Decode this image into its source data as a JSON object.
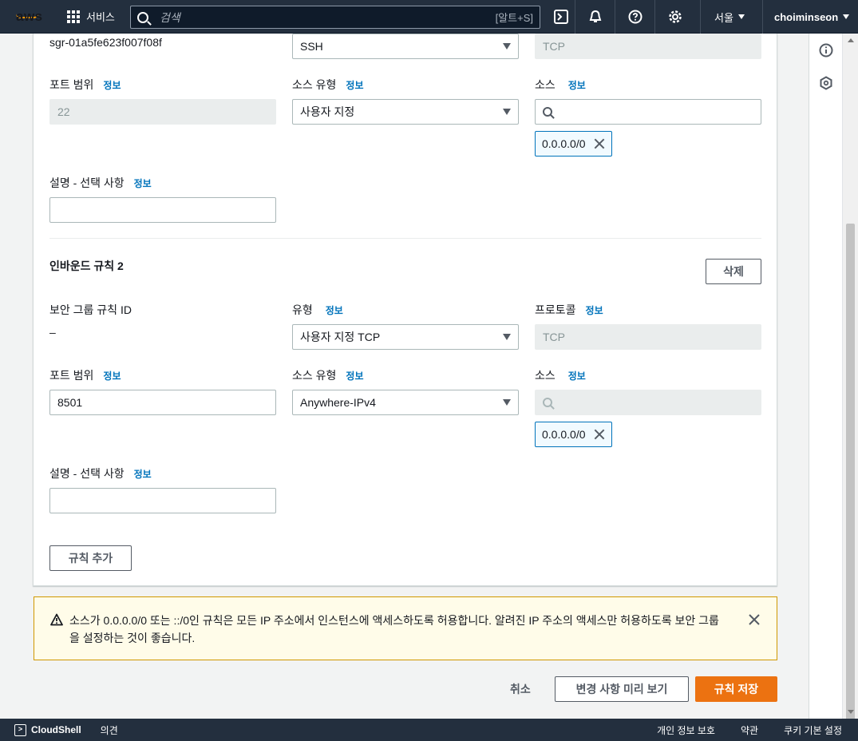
{
  "nav": {
    "logo": "aws",
    "services": "서비스",
    "search_placeholder": "검색",
    "search_shortcut": "[알트+S]",
    "region": "서울",
    "user": "choiminseon"
  },
  "rule1": {
    "sg_rule_id": "sgr-01a5fe623f007f08f",
    "type_value": "SSH",
    "protocol_value": "TCP",
    "port_label": "포트 범위",
    "port_value": "22",
    "source_type_label": "소스 유형",
    "source_type_value": "사용자 지정",
    "source_label": "소스",
    "source_token": "0.0.0.0/0",
    "desc_label": "설명 - 선택 사항",
    "desc_value": ""
  },
  "rule2": {
    "title": "인바운드 규칙 2",
    "delete_label": "삭제",
    "sg_rule_id_label": "보안 그룹 규칙 ID",
    "sg_rule_id": "–",
    "type_label": "유형",
    "type_value": "사용자 지정 TCP",
    "protocol_label": "프로토콜",
    "protocol_value": "TCP",
    "port_label": "포트 범위",
    "port_value": "8501",
    "source_type_label": "소스 유형",
    "source_type_value": "Anywhere-IPv4",
    "source_label": "소스",
    "source_token": "0.0.0.0/0",
    "desc_label": "설명 - 선택 사항",
    "desc_value": ""
  },
  "info_label": "정보",
  "add_rule_label": "규칙 추가",
  "warning_text": "소스가 0.0.0.0/0 또는 ::/0인 규칙은 모든 IP 주소에서 인스턴스에 액세스하도록 허용합니다. 알려진 IP 주소의 액세스만 허용하도록 보안 그룹을 설정하는 것이 좋습니다.",
  "actions": {
    "cancel": "취소",
    "preview": "변경 사항 미리 보기",
    "save": "규칙 저장"
  },
  "footer": {
    "cloudshell": "CloudShell",
    "feedback": "의견",
    "privacy": "개인 정보 보호",
    "terms": "약관",
    "cookies": "쿠키 기본 설정"
  },
  "colors": {
    "nav_bg": "#232f3e",
    "primary": "#ec7211",
    "link": "#0073bb",
    "warning_border": "#d09800"
  }
}
